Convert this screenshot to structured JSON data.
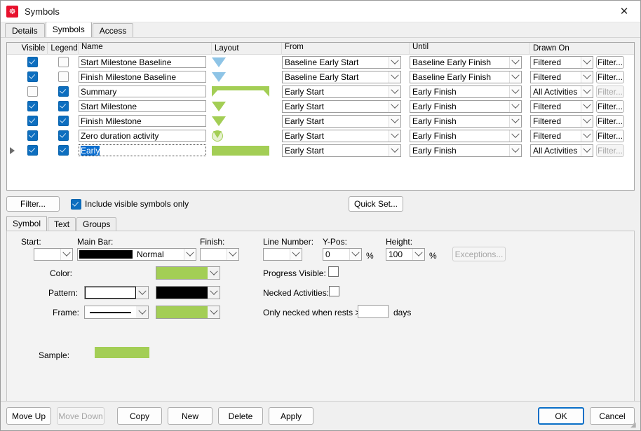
{
  "window": {
    "title": "Symbols",
    "app_icon": "spiral-logo-icon",
    "close_label": "✕"
  },
  "top_tabs": [
    {
      "label": "Details",
      "active": false
    },
    {
      "label": "Symbols",
      "active": true
    },
    {
      "label": "Access",
      "active": false
    }
  ],
  "grid": {
    "headers": {
      "visible": "Visible",
      "legend": "Legend",
      "name": "Name",
      "layout": "Layout",
      "from": "From",
      "until": "Until",
      "drawn_on": "Drawn On"
    },
    "rows": [
      {
        "indicator": false,
        "visible": true,
        "legend": false,
        "name": "Start Milestone Baseline",
        "layout": "triangle-down-blue",
        "from": "Baseline Early Start",
        "until": "Baseline Early Finish",
        "drawn_on": "Filtered",
        "filter_label": "Filter...",
        "filter_enabled": true,
        "selected": false
      },
      {
        "indicator": false,
        "visible": true,
        "legend": false,
        "name": "Finish Milestone Baseline",
        "layout": "triangle-down-blue",
        "from": "Baseline Early Start",
        "until": "Baseline Early Finish",
        "drawn_on": "Filtered",
        "filter_label": "Filter...",
        "filter_enabled": true,
        "selected": false
      },
      {
        "indicator": false,
        "visible": false,
        "legend": true,
        "name": "Summary",
        "layout": "summary-bar-green",
        "from": "Early Start",
        "until": "Early Finish",
        "drawn_on": "All Activities",
        "filter_label": "Filter...",
        "filter_enabled": false,
        "selected": false
      },
      {
        "indicator": false,
        "visible": true,
        "legend": true,
        "name": "Start Milestone",
        "layout": "triangle-down-green",
        "from": "Early Start",
        "until": "Early Finish",
        "drawn_on": "Filtered",
        "filter_label": "Filter...",
        "filter_enabled": true,
        "selected": false
      },
      {
        "indicator": false,
        "visible": true,
        "legend": true,
        "name": "Finish Milestone",
        "layout": "triangle-down-green",
        "from": "Early Start",
        "until": "Early Finish",
        "drawn_on": "Filtered",
        "filter_label": "Filter...",
        "filter_enabled": true,
        "selected": false
      },
      {
        "indicator": false,
        "visible": true,
        "legend": true,
        "name": "Zero duration activity",
        "layout": "circle-triangle-green",
        "from": "Early Start",
        "until": "Early Finish",
        "drawn_on": "Filtered",
        "filter_label": "Filter...",
        "filter_enabled": true,
        "selected": false
      },
      {
        "indicator": true,
        "visible": true,
        "legend": true,
        "name": "Early",
        "layout": "solid-bar-green",
        "from": "Early Start",
        "until": "Early Finish",
        "drawn_on": "All Activities",
        "filter_label": "Filter...",
        "filter_enabled": false,
        "selected": true
      }
    ]
  },
  "midbar": {
    "filter_button": "Filter...",
    "include_visible_label": "Include visible symbols only",
    "include_visible_checked": true,
    "quick_set_button": "Quick Set..."
  },
  "lower_tabs": [
    {
      "label": "Symbol",
      "active": true
    },
    {
      "label": "Text",
      "active": false
    },
    {
      "label": "Groups",
      "active": false
    }
  ],
  "symbol_panel": {
    "start_label": "Start:",
    "start_value": "",
    "main_bar_label": "Main Bar:",
    "main_bar_value": "Normal",
    "finish_label": "Finish:",
    "finish_value": "",
    "color_label": "Color:",
    "color_value": "#a3ce55",
    "pattern_label": "Pattern:",
    "pattern_value": "",
    "pattern_color": "#000000",
    "frame_label": "Frame:",
    "frame_value": "",
    "frame_color": "#a3ce55",
    "line_number_label": "Line Number:",
    "line_number_value": "",
    "ypos_label": "Y-Pos:",
    "ypos_value": "0",
    "ypos_unit": "%",
    "height_label": "Height:",
    "height_value": "100",
    "height_unit": "%",
    "exceptions_button": "Exceptions...",
    "progress_visible_label": "Progress Visible:",
    "progress_visible_checked": false,
    "necked_activities_label": "Necked Activities:",
    "necked_activities_checked": false,
    "only_necked_label": "Only necked when rests >",
    "only_necked_value": "",
    "days_label": "days",
    "sample_label": "Sample:",
    "sample_color": "#a3ce55"
  },
  "bottom_bar": {
    "move_up": "Move Up",
    "move_down": "Move Down",
    "copy": "Copy",
    "new": "New",
    "delete": "Delete",
    "apply": "Apply",
    "ok": "OK",
    "cancel": "Cancel"
  }
}
